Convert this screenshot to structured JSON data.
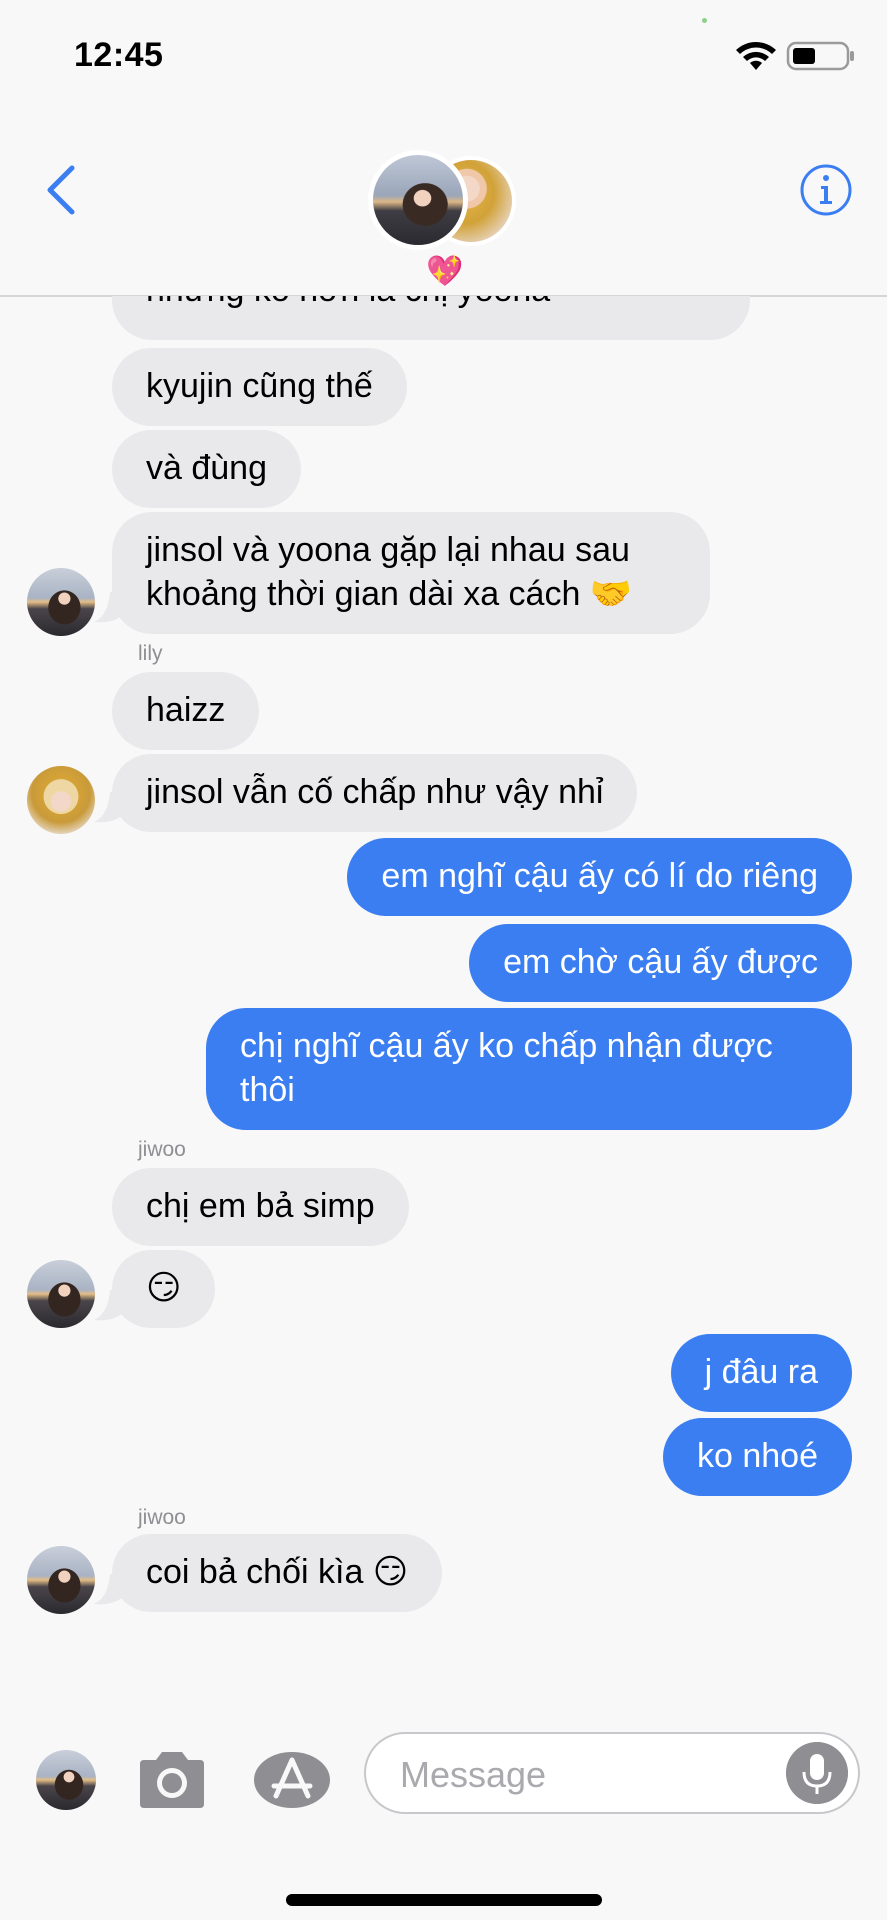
{
  "status": {
    "time": "12:45"
  },
  "header": {
    "group_emoji": "💖"
  },
  "messages": {
    "m0": "nhưng ko hơn là chị yoona",
    "m1": "kyujin cũng thế",
    "m2": "và đùng",
    "m3": "jinsol và yoona gặp lại nhau sau khoảng thời gian dài xa cách 🤝",
    "sender_lily": "lily",
    "m4": "haizz",
    "m5": "jinsol vẫn cố chấp như vậy nhỉ",
    "m6": "em nghĩ cậu ấy có lí do riêng",
    "m7": "em chờ cậu ấy được",
    "m8": "chị nghĩ cậu ấy ko chấp nhận được thôi",
    "sender_jiwoo_1": "jiwoo",
    "m9": "chị em bả simp",
    "m10": "😏",
    "m11": "j đâu ra",
    "m12": "ko nhoé",
    "sender_jiwoo_2": "jiwoo",
    "m13": "coi bả chối kìa 😏"
  },
  "compose": {
    "placeholder": "Message"
  },
  "colors": {
    "accent": "#3a7ef2",
    "incoming_bubble": "#e9e9eb",
    "background": "#f8f8f8"
  },
  "icons": {
    "back": "chevron-left-icon",
    "info": "info-icon",
    "camera": "camera-icon",
    "appstore": "appstore-icon",
    "mic": "microphone-icon",
    "wifi": "wifi-icon",
    "battery": "battery-icon"
  }
}
